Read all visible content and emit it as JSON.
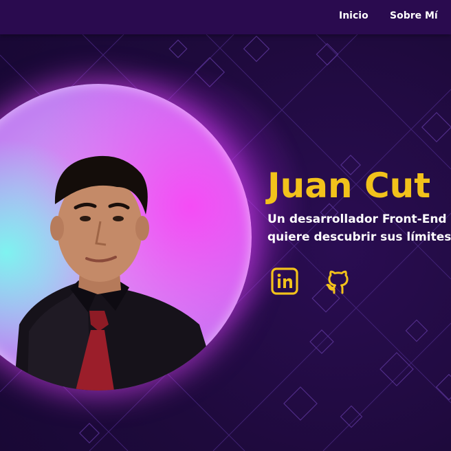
{
  "nav": {
    "items": [
      {
        "label": "Inicio"
      },
      {
        "label": "Sobre Mí"
      }
    ]
  },
  "hero": {
    "name": "Juan Cut",
    "tagline_line1": "Un desarrollador Front-End",
    "tagline_line2": "quiere descubrir sus límites",
    "social": [
      {
        "icon": "linkedin-icon"
      },
      {
        "icon": "github-icon"
      }
    ]
  },
  "colors": {
    "background": "#1e0a3c",
    "navbar": "#2a0b4f",
    "accent_yellow": "#f2c21b",
    "glow_pink": "#e63cff",
    "glow_cyan": "#7ef3f0"
  }
}
